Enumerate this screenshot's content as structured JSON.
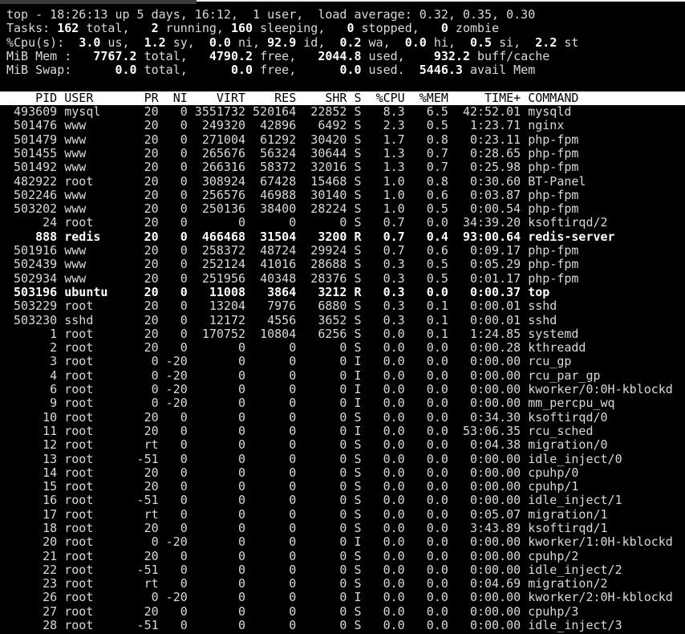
{
  "terminal": {
    "colors": {
      "background": "#000000",
      "text": "#d9d9d9",
      "bold_text": "#ffffff",
      "header_bg": "#ffffff",
      "header_text": "#000000",
      "titlebar_fragment": "#3a3a3a",
      "edge_highlight": "#ececec"
    },
    "summary_lines": [
      [
        {
          "t": "top - 18:26:13 up 5 days, 16:12,  1 user,  load average: 0.32, 0.35, 0.30",
          "b": false
        }
      ],
      [
        {
          "t": "Tasks: ",
          "b": false
        },
        {
          "t": "162",
          "b": true
        },
        {
          "t": " total,   ",
          "b": false
        },
        {
          "t": "2",
          "b": true
        },
        {
          "t": " running, ",
          "b": false
        },
        {
          "t": "160",
          "b": true
        },
        {
          "t": " sleeping,   ",
          "b": false
        },
        {
          "t": "0",
          "b": true
        },
        {
          "t": " stopped,   ",
          "b": false
        },
        {
          "t": "0",
          "b": true
        },
        {
          "t": " zombie",
          "b": false
        }
      ],
      [
        {
          "t": "%Cpu(s):  ",
          "b": false
        },
        {
          "t": "3.0",
          "b": true
        },
        {
          "t": " us,  ",
          "b": false
        },
        {
          "t": "1.2",
          "b": true
        },
        {
          "t": " sy,  ",
          "b": false
        },
        {
          "t": "0.0",
          "b": true
        },
        {
          "t": " ni, ",
          "b": false
        },
        {
          "t": "92.9",
          "b": true
        },
        {
          "t": " id,  ",
          "b": false
        },
        {
          "t": "0.2",
          "b": true
        },
        {
          "t": " wa,  ",
          "b": false
        },
        {
          "t": "0.0",
          "b": true
        },
        {
          "t": " hi,  ",
          "b": false
        },
        {
          "t": "0.5",
          "b": true
        },
        {
          "t": " si,  ",
          "b": false
        },
        {
          "t": "2.2",
          "b": true
        },
        {
          "t": " st",
          "b": false
        }
      ],
      [
        {
          "t": "MiB Mem :   ",
          "b": false
        },
        {
          "t": "7767.2",
          "b": true
        },
        {
          "t": " total,   ",
          "b": false
        },
        {
          "t": "4790.2",
          "b": true
        },
        {
          "t": " free,   ",
          "b": false
        },
        {
          "t": "2044.8",
          "b": true
        },
        {
          "t": " used,    ",
          "b": false
        },
        {
          "t": "932.2",
          "b": true
        },
        {
          "t": " buff/cache",
          "b": false
        }
      ],
      [
        {
          "t": "MiB Swap:      ",
          "b": false
        },
        {
          "t": "0.0",
          "b": true
        },
        {
          "t": " total,      ",
          "b": false
        },
        {
          "t": "0.0",
          "b": true
        },
        {
          "t": " free,      ",
          "b": false
        },
        {
          "t": "0.0",
          "b": true
        },
        {
          "t": " used.  ",
          "b": false
        },
        {
          "t": "5446.3",
          "b": true
        },
        {
          "t": " avail Mem",
          "b": false
        }
      ]
    ],
    "table": {
      "headers": {
        "pid": "PID",
        "user": "USER",
        "pr": "PR",
        "ni": "NI",
        "virt": "VIRT",
        "res": "RES",
        "shr": "SHR",
        "s": "S",
        "cpu": "%CPU",
        "mem": "%MEM",
        "time": "TIME+",
        "command": "COMMAND"
      },
      "rows": [
        {
          "pid": "493609",
          "user": "mysql",
          "pr": "20",
          "ni": "0",
          "virt": "3551732",
          "res": "520164",
          "shr": "22852",
          "s": "S",
          "cpu": "8.3",
          "mem": "6.5",
          "time": "42:52.01",
          "command": "mysqld",
          "bold": false
        },
        {
          "pid": "501476",
          "user": "www",
          "pr": "20",
          "ni": "0",
          "virt": "249320",
          "res": "42896",
          "shr": "6492",
          "s": "S",
          "cpu": "2.3",
          "mem": "0.5",
          "time": "1:23.71",
          "command": "nginx",
          "bold": false
        },
        {
          "pid": "501479",
          "user": "www",
          "pr": "20",
          "ni": "0",
          "virt": "271004",
          "res": "61292",
          "shr": "30420",
          "s": "S",
          "cpu": "1.7",
          "mem": "0.8",
          "time": "0:23.11",
          "command": "php-fpm",
          "bold": false
        },
        {
          "pid": "501455",
          "user": "www",
          "pr": "20",
          "ni": "0",
          "virt": "265676",
          "res": "56324",
          "shr": "30644",
          "s": "S",
          "cpu": "1.3",
          "mem": "0.7",
          "time": "0:28.65",
          "command": "php-fpm",
          "bold": false
        },
        {
          "pid": "501492",
          "user": "www",
          "pr": "20",
          "ni": "0",
          "virt": "266316",
          "res": "58372",
          "shr": "32016",
          "s": "S",
          "cpu": "1.3",
          "mem": "0.7",
          "time": "0:25.98",
          "command": "php-fpm",
          "bold": false
        },
        {
          "pid": "482922",
          "user": "root",
          "pr": "20",
          "ni": "0",
          "virt": "308924",
          "res": "67428",
          "shr": "15468",
          "s": "S",
          "cpu": "1.0",
          "mem": "0.8",
          "time": "0:30.60",
          "command": "BT-Panel",
          "bold": false
        },
        {
          "pid": "502246",
          "user": "www",
          "pr": "20",
          "ni": "0",
          "virt": "256576",
          "res": "46988",
          "shr": "30140",
          "s": "S",
          "cpu": "1.0",
          "mem": "0.6",
          "time": "0:03.87",
          "command": "php-fpm",
          "bold": false
        },
        {
          "pid": "503202",
          "user": "www",
          "pr": "20",
          "ni": "0",
          "virt": "250136",
          "res": "38400",
          "shr": "28224",
          "s": "S",
          "cpu": "1.0",
          "mem": "0.5",
          "time": "0:00.54",
          "command": "php-fpm",
          "bold": false
        },
        {
          "pid": "24",
          "user": "root",
          "pr": "20",
          "ni": "0",
          "virt": "0",
          "res": "0",
          "shr": "0",
          "s": "S",
          "cpu": "0.7",
          "mem": "0.0",
          "time": "34:39.20",
          "command": "ksoftirqd/2",
          "bold": false
        },
        {
          "pid": "888",
          "user": "redis",
          "pr": "20",
          "ni": "0",
          "virt": "466468",
          "res": "31504",
          "shr": "3200",
          "s": "R",
          "cpu": "0.7",
          "mem": "0.4",
          "time": "93:00.64",
          "command": "redis-server",
          "bold": true
        },
        {
          "pid": "501916",
          "user": "www",
          "pr": "20",
          "ni": "0",
          "virt": "258372",
          "res": "48724",
          "shr": "29924",
          "s": "S",
          "cpu": "0.7",
          "mem": "0.6",
          "time": "0:09.17",
          "command": "php-fpm",
          "bold": false
        },
        {
          "pid": "502439",
          "user": "www",
          "pr": "20",
          "ni": "0",
          "virt": "252124",
          "res": "41016",
          "shr": "28688",
          "s": "S",
          "cpu": "0.3",
          "mem": "0.5",
          "time": "0:05.29",
          "command": "php-fpm",
          "bold": false
        },
        {
          "pid": "502934",
          "user": "www",
          "pr": "20",
          "ni": "0",
          "virt": "251956",
          "res": "40348",
          "shr": "28376",
          "s": "S",
          "cpu": "0.3",
          "mem": "0.5",
          "time": "0:01.17",
          "command": "php-fpm",
          "bold": false
        },
        {
          "pid": "503196",
          "user": "ubuntu",
          "pr": "20",
          "ni": "0",
          "virt": "11008",
          "res": "3864",
          "shr": "3212",
          "s": "R",
          "cpu": "0.3",
          "mem": "0.0",
          "time": "0:00.37",
          "command": "top",
          "bold": true
        },
        {
          "pid": "503229",
          "user": "root",
          "pr": "20",
          "ni": "0",
          "virt": "13204",
          "res": "7976",
          "shr": "6880",
          "s": "S",
          "cpu": "0.3",
          "mem": "0.1",
          "time": "0:00.01",
          "command": "sshd",
          "bold": false
        },
        {
          "pid": "503230",
          "user": "sshd",
          "pr": "20",
          "ni": "0",
          "virt": "12172",
          "res": "4556",
          "shr": "3652",
          "s": "S",
          "cpu": "0.3",
          "mem": "0.1",
          "time": "0:00.01",
          "command": "sshd",
          "bold": false
        },
        {
          "pid": "1",
          "user": "root",
          "pr": "20",
          "ni": "0",
          "virt": "170752",
          "res": "10804",
          "shr": "6256",
          "s": "S",
          "cpu": "0.0",
          "mem": "0.1",
          "time": "1:24.85",
          "command": "systemd",
          "bold": false
        },
        {
          "pid": "2",
          "user": "root",
          "pr": "20",
          "ni": "0",
          "virt": "0",
          "res": "0",
          "shr": "0",
          "s": "S",
          "cpu": "0.0",
          "mem": "0.0",
          "time": "0:00.28",
          "command": "kthreadd",
          "bold": false
        },
        {
          "pid": "3",
          "user": "root",
          "pr": "0",
          "ni": "-20",
          "virt": "0",
          "res": "0",
          "shr": "0",
          "s": "I",
          "cpu": "0.0",
          "mem": "0.0",
          "time": "0:00.00",
          "command": "rcu_gp",
          "bold": false
        },
        {
          "pid": "4",
          "user": "root",
          "pr": "0",
          "ni": "-20",
          "virt": "0",
          "res": "0",
          "shr": "0",
          "s": "I",
          "cpu": "0.0",
          "mem": "0.0",
          "time": "0:00.00",
          "command": "rcu_par_gp",
          "bold": false
        },
        {
          "pid": "6",
          "user": "root",
          "pr": "0",
          "ni": "-20",
          "virt": "0",
          "res": "0",
          "shr": "0",
          "s": "I",
          "cpu": "0.0",
          "mem": "0.0",
          "time": "0:00.00",
          "command": "kworker/0:0H-kblockd",
          "bold": false
        },
        {
          "pid": "9",
          "user": "root",
          "pr": "0",
          "ni": "-20",
          "virt": "0",
          "res": "0",
          "shr": "0",
          "s": "I",
          "cpu": "0.0",
          "mem": "0.0",
          "time": "0:00.00",
          "command": "mm_percpu_wq",
          "bold": false
        },
        {
          "pid": "10",
          "user": "root",
          "pr": "20",
          "ni": "0",
          "virt": "0",
          "res": "0",
          "shr": "0",
          "s": "S",
          "cpu": "0.0",
          "mem": "0.0",
          "time": "0:34.30",
          "command": "ksoftirqd/0",
          "bold": false
        },
        {
          "pid": "11",
          "user": "root",
          "pr": "20",
          "ni": "0",
          "virt": "0",
          "res": "0",
          "shr": "0",
          "s": "I",
          "cpu": "0.0",
          "mem": "0.0",
          "time": "53:06.35",
          "command": "rcu_sched",
          "bold": false
        },
        {
          "pid": "12",
          "user": "root",
          "pr": "rt",
          "ni": "0",
          "virt": "0",
          "res": "0",
          "shr": "0",
          "s": "S",
          "cpu": "0.0",
          "mem": "0.0",
          "time": "0:04.38",
          "command": "migration/0",
          "bold": false
        },
        {
          "pid": "13",
          "user": "root",
          "pr": "-51",
          "ni": "0",
          "virt": "0",
          "res": "0",
          "shr": "0",
          "s": "S",
          "cpu": "0.0",
          "mem": "0.0",
          "time": "0:00.00",
          "command": "idle_inject/0",
          "bold": false
        },
        {
          "pid": "14",
          "user": "root",
          "pr": "20",
          "ni": "0",
          "virt": "0",
          "res": "0",
          "shr": "0",
          "s": "S",
          "cpu": "0.0",
          "mem": "0.0",
          "time": "0:00.00",
          "command": "cpuhp/0",
          "bold": false
        },
        {
          "pid": "15",
          "user": "root",
          "pr": "20",
          "ni": "0",
          "virt": "0",
          "res": "0",
          "shr": "0",
          "s": "S",
          "cpu": "0.0",
          "mem": "0.0",
          "time": "0:00.00",
          "command": "cpuhp/1",
          "bold": false
        },
        {
          "pid": "16",
          "user": "root",
          "pr": "-51",
          "ni": "0",
          "virt": "0",
          "res": "0",
          "shr": "0",
          "s": "S",
          "cpu": "0.0",
          "mem": "0.0",
          "time": "0:00.00",
          "command": "idle_inject/1",
          "bold": false
        },
        {
          "pid": "17",
          "user": "root",
          "pr": "rt",
          "ni": "0",
          "virt": "0",
          "res": "0",
          "shr": "0",
          "s": "S",
          "cpu": "0.0",
          "mem": "0.0",
          "time": "0:05.07",
          "command": "migration/1",
          "bold": false
        },
        {
          "pid": "18",
          "user": "root",
          "pr": "20",
          "ni": "0",
          "virt": "0",
          "res": "0",
          "shr": "0",
          "s": "S",
          "cpu": "0.0",
          "mem": "0.0",
          "time": "3:43.89",
          "command": "ksoftirqd/1",
          "bold": false
        },
        {
          "pid": "20",
          "user": "root",
          "pr": "0",
          "ni": "-20",
          "virt": "0",
          "res": "0",
          "shr": "0",
          "s": "I",
          "cpu": "0.0",
          "mem": "0.0",
          "time": "0:00.00",
          "command": "kworker/1:0H-kblockd",
          "bold": false
        },
        {
          "pid": "21",
          "user": "root",
          "pr": "20",
          "ni": "0",
          "virt": "0",
          "res": "0",
          "shr": "0",
          "s": "S",
          "cpu": "0.0",
          "mem": "0.0",
          "time": "0:00.00",
          "command": "cpuhp/2",
          "bold": false
        },
        {
          "pid": "22",
          "user": "root",
          "pr": "-51",
          "ni": "0",
          "virt": "0",
          "res": "0",
          "shr": "0",
          "s": "S",
          "cpu": "0.0",
          "mem": "0.0",
          "time": "0:00.00",
          "command": "idle_inject/2",
          "bold": false
        },
        {
          "pid": "23",
          "user": "root",
          "pr": "rt",
          "ni": "0",
          "virt": "0",
          "res": "0",
          "shr": "0",
          "s": "S",
          "cpu": "0.0",
          "mem": "0.0",
          "time": "0:04.69",
          "command": "migration/2",
          "bold": false
        },
        {
          "pid": "26",
          "user": "root",
          "pr": "0",
          "ni": "-20",
          "virt": "0",
          "res": "0",
          "shr": "0",
          "s": "I",
          "cpu": "0.0",
          "mem": "0.0",
          "time": "0:00.00",
          "command": "kworker/2:0H-kblockd",
          "bold": false
        },
        {
          "pid": "27",
          "user": "root",
          "pr": "20",
          "ni": "0",
          "virt": "0",
          "res": "0",
          "shr": "0",
          "s": "S",
          "cpu": "0.0",
          "mem": "0.0",
          "time": "0:00.00",
          "command": "cpuhp/3",
          "bold": false
        },
        {
          "pid": "28",
          "user": "root",
          "pr": "-51",
          "ni": "0",
          "virt": "0",
          "res": "0",
          "shr": "0",
          "s": "S",
          "cpu": "0.0",
          "mem": "0.0",
          "time": "0:00.00",
          "command": "idle_inject/3",
          "bold": false
        }
      ]
    }
  }
}
